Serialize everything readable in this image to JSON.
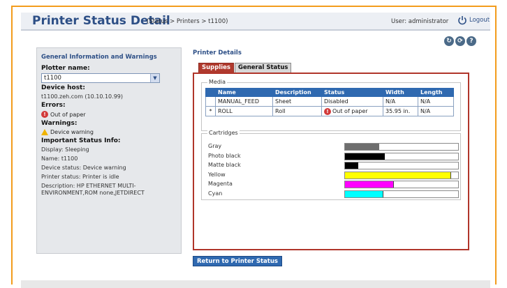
{
  "header": {
    "title": "Printer Status Detail",
    "breadcrumb": "(Status > Printers > t1100)",
    "user": "User: administrator",
    "logout": "Logout"
  },
  "left": {
    "section_title": "General Information and Warnings",
    "plotter_label": "Plotter name:",
    "plotter_value": "t1100",
    "host_label": "Device host:",
    "host_value": "t1100.zeh.com (10.10.10.99)",
    "errors_label": "Errors:",
    "error_item": "Out of paper",
    "warnings_label": "Warnings:",
    "warning_item": "Device warning",
    "status_label": "Important Status Info:",
    "display": "Display: Sleeping",
    "name": "Name: t1100",
    "device_status": "Device status: Device warning",
    "printer_status": "Printer status: Printer is idle",
    "description": "Description: HP ETHERNET MULTI-ENVIRONMENT,ROM none,JETDIRECT"
  },
  "right": {
    "title": "Printer Details",
    "tabs": [
      "Supplies",
      "General Status"
    ],
    "media_legend": "Media",
    "media_headers": [
      "Name",
      "Description",
      "Status",
      "Width",
      "Length"
    ],
    "media_rows": [
      {
        "marker": "",
        "name": "MANUAL_FEED",
        "description": "Sheet",
        "status": "Disabled",
        "width": "N/A",
        "length": "N/A"
      },
      {
        "marker": "*",
        "name": "ROLL",
        "description": "Roll",
        "status": "Out of paper",
        "width": "35.95 in.",
        "length": "N/A"
      }
    ],
    "cartridges_legend": "Cartridges",
    "cartridges": [
      {
        "name": "Gray",
        "color": "#6e6e6e",
        "level": 0.3
      },
      {
        "name": "Photo black",
        "color": "#000000",
        "level": 0.35
      },
      {
        "name": "Matte black",
        "color": "#000000",
        "level": 0.12
      },
      {
        "name": "Yellow",
        "color": "#ffff00",
        "level": 0.94
      },
      {
        "name": "Magenta",
        "color": "#ff00ff",
        "level": 0.43
      },
      {
        "name": "Cyan",
        "color": "#00ffff",
        "level": 0.34
      }
    ],
    "return_button": "Return to Printer Status"
  },
  "icons": {
    "toolbar": [
      "refresh-icon",
      "refresh-all-icon",
      "help-icon"
    ]
  }
}
